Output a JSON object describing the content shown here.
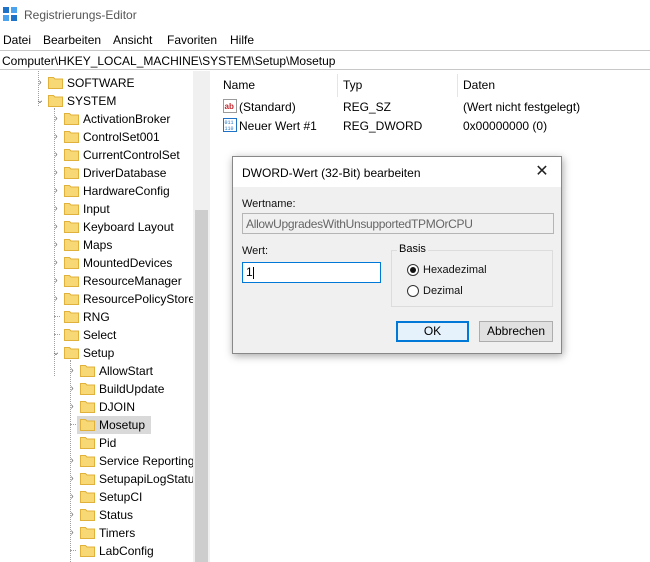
{
  "window": {
    "title": "Registrierungs-Editor"
  },
  "menu": [
    "Datei",
    "Bearbeiten",
    "Ansicht",
    "Favoriten",
    "Hilfe"
  ],
  "address": "Computer\\HKEY_LOCAL_MACHINE\\SYSTEM\\Setup\\Mosetup",
  "tree": {
    "top": [
      {
        "label": "SOFTWARE"
      },
      {
        "label": "SYSTEM"
      }
    ],
    "system_children": [
      "ActivationBroker",
      "ControlSet001",
      "CurrentControlSet",
      "DriverDatabase",
      "HardwareConfig",
      "Input",
      "Keyboard Layout",
      "Maps",
      "MountedDevices",
      "ResourceManager",
      "ResourcePolicyStore",
      "RNG",
      "Select",
      "Setup"
    ],
    "setup_children": [
      "AllowStart",
      "BuildUpdate",
      "DJOIN",
      "Mosetup",
      "Pid",
      "Service Reporting",
      "SetupapiLogStatu",
      "SetupCI",
      "Status",
      "Timers",
      "LabConfig"
    ],
    "selected": "Mosetup"
  },
  "list": {
    "columns": {
      "name": "Name",
      "type": "Typ",
      "data": "Daten"
    },
    "rows": [
      {
        "name": "(Standard)",
        "type": "REG_SZ",
        "data": "(Wert nicht festgelegt)",
        "icon": "string-value-icon"
      },
      {
        "name": "Neuer Wert #1",
        "type": "REG_DWORD",
        "data": "0x00000000 (0)",
        "icon": "binary-value-icon"
      }
    ]
  },
  "dialog": {
    "title": "DWORD-Wert (32-Bit) bearbeiten",
    "close": "✕",
    "name_label": "Wertname:",
    "name_value": "AllowUpgradesWithUnsupportedTPMOrCPU",
    "value_label": "Wert:",
    "value": "1",
    "base_label": "Basis",
    "radio_hex": "Hexadezimal",
    "radio_dec": "Dezimal",
    "selected_base": "Hexadezimal",
    "ok": "OK",
    "cancel": "Abbrechen"
  },
  "colors": {
    "accent": "#0078d7",
    "folder": "#f8d775",
    "folder_dark": "#e0b23c"
  }
}
